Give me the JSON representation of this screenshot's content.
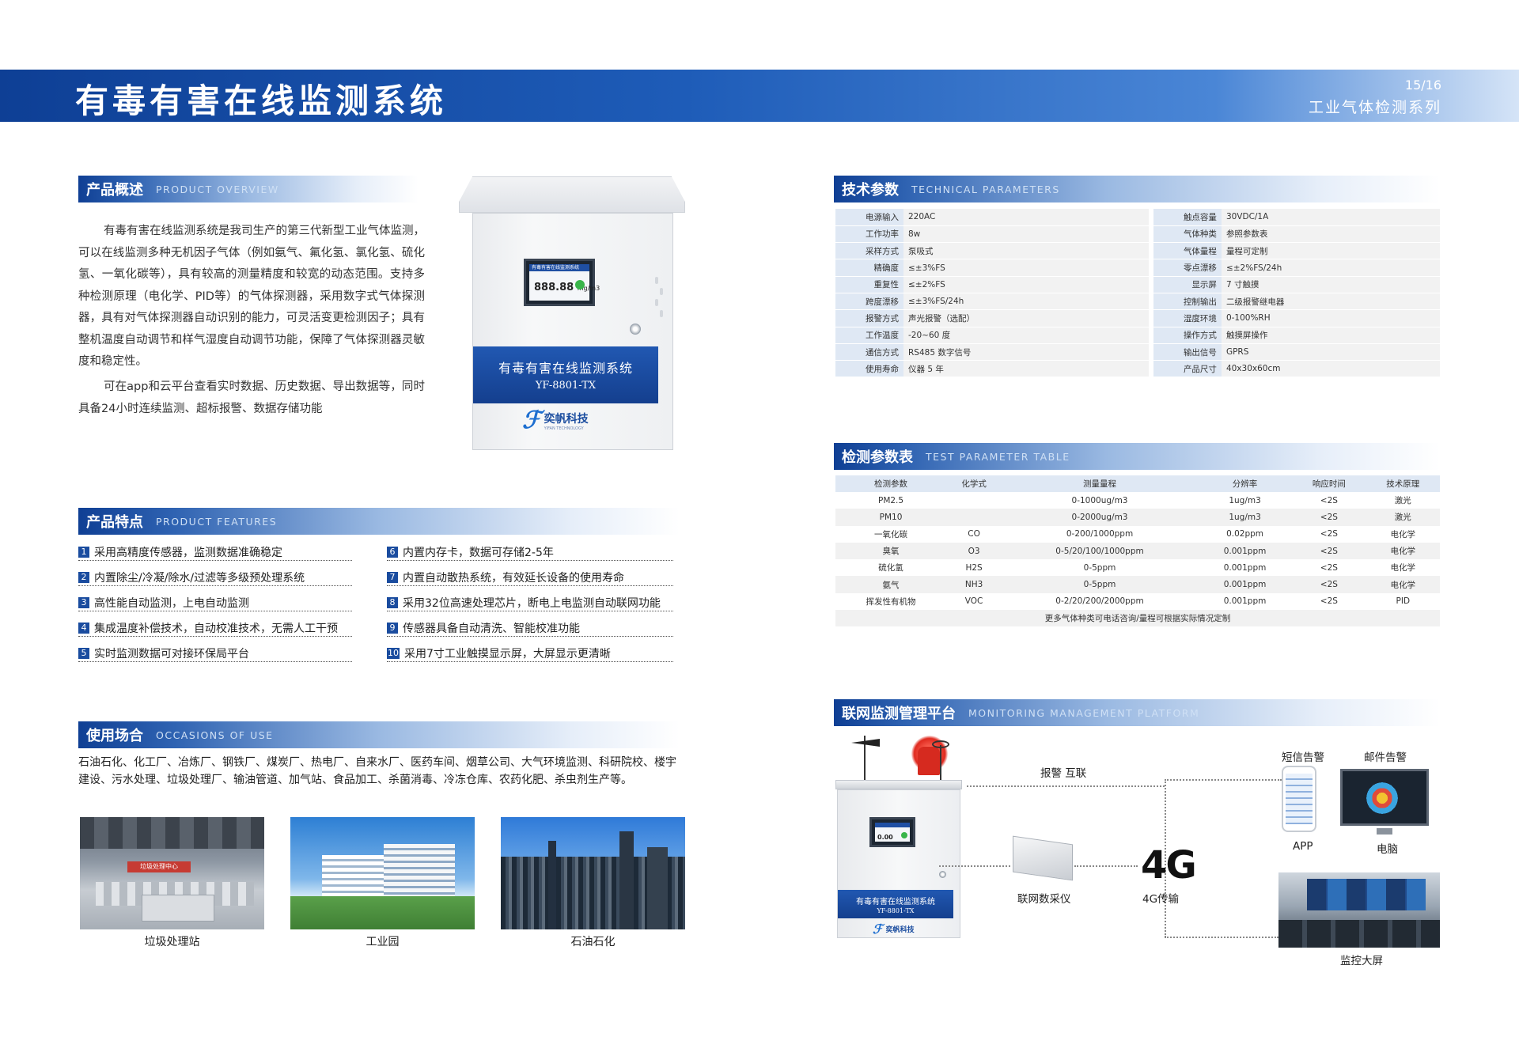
{
  "banner": {
    "title": "有毒有害在线监测系统",
    "page": "15/16",
    "series": "工业气体检测系列"
  },
  "overview": {
    "title_cn": "产品概述",
    "title_en": "PRODUCT OVERVIEW",
    "p1": "有毒有害在线监测系统是我司生产的第三代新型工业气体监测，可以在线监测多种无机因子气体（例如氨气、氟化氢、氯化氢、硫化氢、一氧化碳等），具有较高的测量精度和较宽的动态范围。支持多种检测原理（电化学、PID等）的气体探测器，采用数字式气体探测器，具有对气体探测器自动识别的能力，可灵活变更检测因子；具有整机温度自动调节和样气湿度自动调节功能，保障了气体探测器灵敏度和稳定性。",
    "p2": "可在app和云平台查看实时数据、历史数据、导出数据等，同时具备24小时连续监测、超标报警、数据存储功能"
  },
  "product": {
    "panel_line1": "有毒有害在线监测系统",
    "panel_line2": "YF-8801-TX",
    "screen_title": "有毒有害在线监测系统",
    "screen_value": "888.88",
    "screen_unit": "mg/m3",
    "logo_text": "奕帆科技",
    "logo_sub": "YIFAN TECHNOLOGY"
  },
  "features": {
    "title_cn": "产品特点",
    "title_en": "PRODUCT FEATURES",
    "items": [
      {
        "num": "1",
        "text": "采用高精度传感器，监测数据准确稳定"
      },
      {
        "num": "2",
        "text": "内置除尘/冷凝/除水/过滤等多级预处理系统"
      },
      {
        "num": "3",
        "text": "高性能自动监测，上电自动监测"
      },
      {
        "num": "4",
        "text": "集成温度补偿技术，自动校准技术，无需人工干预"
      },
      {
        "num": "5",
        "text": "实时监测数据可对接环保局平台"
      },
      {
        "num": "6",
        "text": "内置内存卡，数据可存储2-5年"
      },
      {
        "num": "7",
        "text": "内置自动散热系统，有效延长设备的使用寿命"
      },
      {
        "num": "8",
        "text": "采用32位高速处理芯片，断电上电监测自动联网功能"
      },
      {
        "num": "9",
        "text": "传感器具备自动清洗、智能校准功能"
      },
      {
        "num": "10",
        "text": "采用7寸工业触摸显示屏，大屏显示更清晰"
      }
    ]
  },
  "occasions": {
    "title_cn": "使用场合",
    "title_en": "OCCASIONS OF USE",
    "text": "石油石化、化工厂、冶炼厂、钢铁厂、煤炭厂、热电厂、自来水厂、医药车间、烟草公司、大气环境监测、科研院校、楼宇建设、污水处理、垃圾处理厂、输油管道、加气站、食品加工、杀菌消毒、冷冻仓库、农药化肥、杀虫剂生产等。",
    "photos": [
      {
        "caption": "垃圾处理站",
        "sign": "垃圾处理中心"
      },
      {
        "caption": "工业园"
      },
      {
        "caption": "石油石化"
      }
    ]
  },
  "tech": {
    "title_cn": "技术参数",
    "title_en": "TECHNICAL PARAMETERS",
    "rows": [
      [
        "电源输入",
        "220AC",
        "触点容量",
        "30VDC/1A"
      ],
      [
        "工作功率",
        "8w",
        "气体种类",
        "参照参数表"
      ],
      [
        "采样方式",
        "泵吸式",
        "气体量程",
        "量程可定制"
      ],
      [
        "精确度",
        "≤±3%FS",
        "零点漂移",
        "≤±2%FS/24h"
      ],
      [
        "重复性",
        "≤±2%FS",
        "显示屏",
        "7 寸触摸"
      ],
      [
        "跨度漂移",
        "≤±3%FS/24h",
        "控制输出",
        "二级报警继电器"
      ],
      [
        "报警方式",
        "声光报警（选配）",
        "湿度环境",
        "0-100%RH"
      ],
      [
        "工作温度",
        "-20~60 度",
        "操作方式",
        "触摸屏操作"
      ],
      [
        "通信方式",
        "RS485 数字信号",
        "输出信号",
        "GPRS"
      ],
      [
        "使用寿命",
        "仪器 5 年",
        "产品尺寸",
        "40x30x60cm"
      ]
    ]
  },
  "test": {
    "title_cn": "检测参数表",
    "title_en": "TEST PARAMETER TABLE",
    "headers": [
      "检测参数",
      "化学式",
      "测量量程",
      "分辨率",
      "响应时间",
      "技术原理"
    ],
    "rows": [
      [
        "PM2.5",
        "",
        "0-1000ug/m3",
        "1ug/m3",
        "<2S",
        "激光"
      ],
      [
        "PM10",
        "",
        "0-2000ug/m3",
        "1ug/m3",
        "<2S",
        "激光"
      ],
      [
        "一氧化碳",
        "CO",
        "0-200/1000ppm",
        "0.02ppm",
        "<2S",
        "电化学"
      ],
      [
        "臭氧",
        "O3",
        "0-5/20/100/1000ppm",
        "0.001ppm",
        "<2S",
        "电化学"
      ],
      [
        "硫化氢",
        "H2S",
        "0-5ppm",
        "0.001ppm",
        "<2S",
        "电化学"
      ],
      [
        "氨气",
        "NH3",
        "0-5ppm",
        "0.001ppm",
        "<2S",
        "电化学"
      ],
      [
        "挥发性有机物",
        "VOC",
        "0-2/20/200/2000ppm",
        "0.001ppm",
        "<2S",
        "PID"
      ]
    ],
    "note": "更多气体种类可电话咨询/量程可根据实际情况定制"
  },
  "platform": {
    "title_cn": "联网监测管理平台",
    "title_en": "MONITORING MANAGEMENT PLATFORM",
    "alarm_link": "报警  互联",
    "collector": "联网数采仪",
    "transfer_big": "4G",
    "transfer": "4G传输",
    "sms": "短信告警",
    "mail": "邮件告警",
    "app": "APP",
    "pc": "电脑",
    "bigscreen": "监控大屏",
    "device_line1": "有毒有害在线监测系统",
    "device_line2": "YF-8801-TX",
    "device_screen_value": "0.00",
    "device_logo": "奕帆科技"
  }
}
